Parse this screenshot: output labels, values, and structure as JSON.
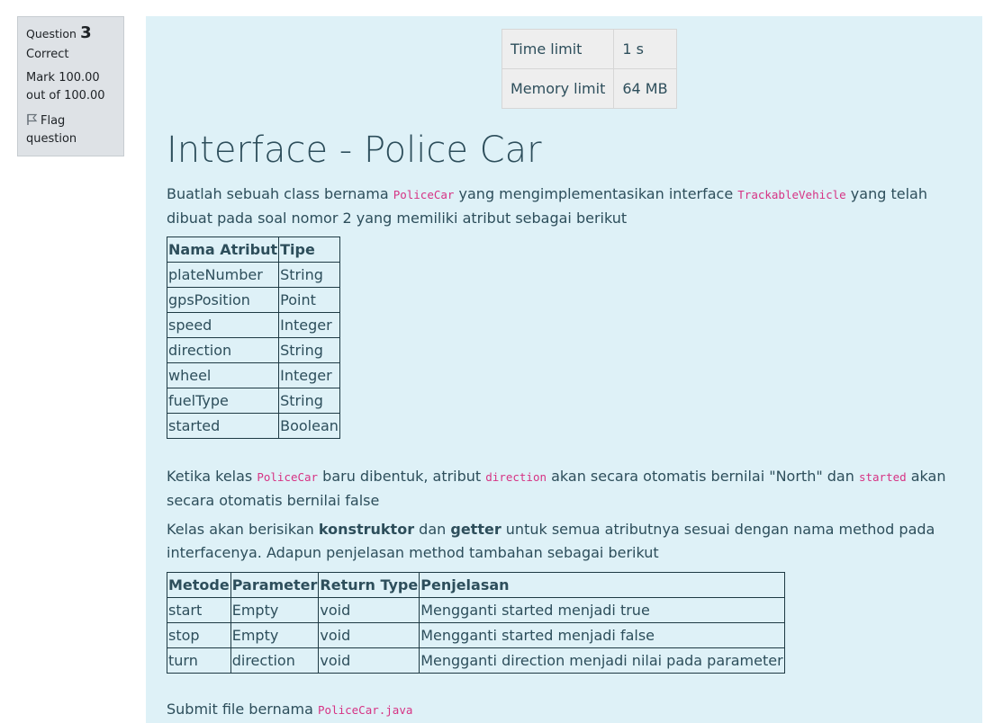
{
  "question_info": {
    "label": "Question",
    "number": "3",
    "state": "Correct",
    "grade": "Mark 100.00 out of 100.00",
    "flag_label": "Flag question"
  },
  "limits": [
    {
      "name": "Time limit",
      "value": "1 s"
    },
    {
      "name": "Memory limit",
      "value": "64 MB"
    }
  ],
  "title": "Interface - Police Car",
  "intro": {
    "t1": "Buatlah sebuah class bernama ",
    "c1": "PoliceCar",
    "t2": " yang mengimplementasikan interface ",
    "c2": "TrackableVehicle",
    "t3": " yang telah dibuat pada soal nomor 2 yang memiliki atribut sebagai berikut"
  },
  "attributes_table": {
    "headers": [
      "Nama Atribut",
      "Tipe"
    ],
    "rows": [
      [
        "plateNumber",
        "String"
      ],
      [
        "gpsPosition",
        "Point"
      ],
      [
        "speed",
        "Integer"
      ],
      [
        "direction",
        "String"
      ],
      [
        "wheel",
        "Integer"
      ],
      [
        "fuelType",
        "String"
      ],
      [
        "started",
        "Boolean"
      ]
    ]
  },
  "para2": {
    "t1": "Ketika kelas ",
    "c1": "PoliceCar",
    "t2": " baru dibentuk, atribut ",
    "c2": "direction",
    "t3": " akan secara otomatis bernilai \"North\" dan ",
    "c3": "started",
    "t4": " akan secara otomatis bernilai false"
  },
  "para3": {
    "t1": "Kelas akan berisikan ",
    "b1": "konstruktor",
    "t2": " dan ",
    "b2": "getter",
    "t3": " untuk semua atributnya sesuai dengan nama method pada interfacenya. Adapun penjelasan method tambahan sebagai berikut"
  },
  "methods_table": {
    "headers": [
      "Metode",
      "Parameter",
      "Return Type",
      "Penjelasan"
    ],
    "rows": [
      [
        "start",
        "Empty",
        "void",
        "Mengganti started menjadi true"
      ],
      [
        "stop",
        "Empty",
        "void",
        "Mengganti started menjadi false"
      ],
      [
        "turn",
        "direction",
        "void",
        "Mengganti direction menjadi nilai pada parameter"
      ]
    ]
  },
  "submit": {
    "t1": "Submit file bernama ",
    "c1": "PoliceCar.java"
  }
}
